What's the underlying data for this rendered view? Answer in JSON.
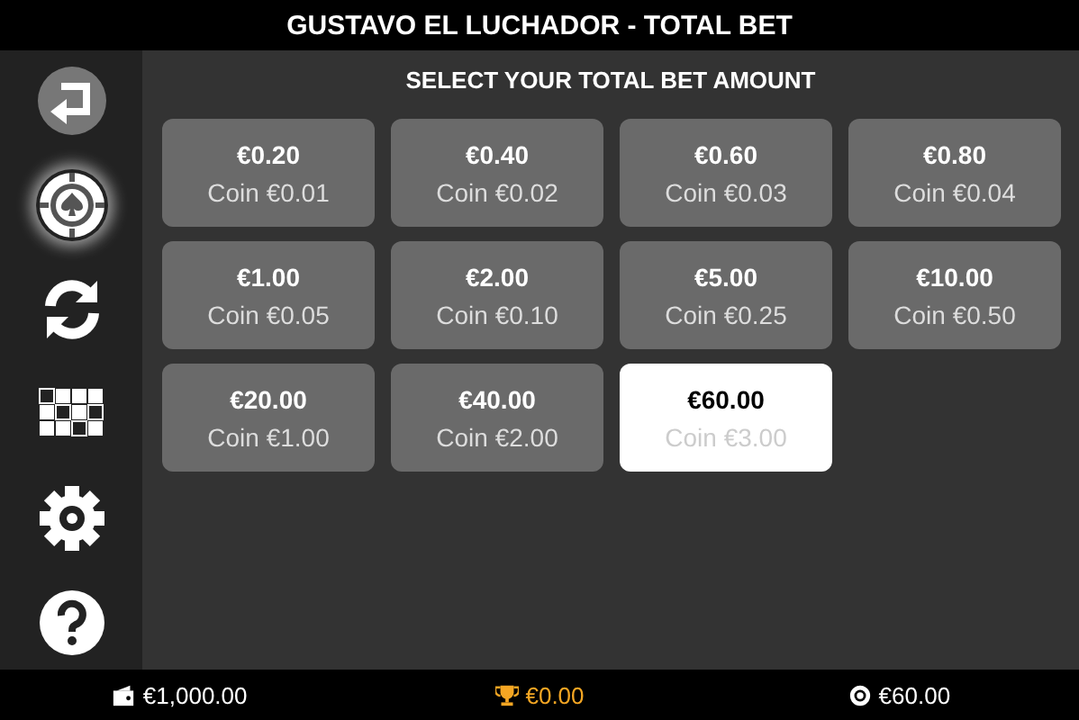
{
  "header": {
    "title": "GUSTAVO EL LUCHADOR - TOTAL BET"
  },
  "sidebar": {
    "items": [
      {
        "kind": "back",
        "selected": false
      },
      {
        "kind": "bet",
        "selected": true
      },
      {
        "kind": "autoplay",
        "selected": false
      },
      {
        "kind": "paytable",
        "selected": false
      },
      {
        "kind": "settings",
        "selected": false
      },
      {
        "kind": "help",
        "selected": false
      }
    ]
  },
  "panel": {
    "heading": "SELECT YOUR TOTAL BET AMOUNT",
    "options": [
      {
        "amount": "€0.20",
        "coin": "Coin €0.01",
        "selected": false
      },
      {
        "amount": "€0.40",
        "coin": "Coin €0.02",
        "selected": false
      },
      {
        "amount": "€0.60",
        "coin": "Coin €0.03",
        "selected": false
      },
      {
        "amount": "€0.80",
        "coin": "Coin €0.04",
        "selected": false
      },
      {
        "amount": "€1.00",
        "coin": "Coin €0.05",
        "selected": false
      },
      {
        "amount": "€2.00",
        "coin": "Coin €0.10",
        "selected": false
      },
      {
        "amount": "€5.00",
        "coin": "Coin €0.25",
        "selected": false
      },
      {
        "amount": "€10.00",
        "coin": "Coin €0.50",
        "selected": false
      },
      {
        "amount": "€20.00",
        "coin": "Coin €1.00",
        "selected": false
      },
      {
        "amount": "€40.00",
        "coin": "Coin €2.00",
        "selected": false
      },
      {
        "amount": "€60.00",
        "coin": "Coin €3.00",
        "selected": true
      }
    ]
  },
  "status_bar": [
    {
      "kind": "balance",
      "value": "€1,000.00"
    },
    {
      "kind": "win",
      "value": "€0.00"
    },
    {
      "kind": "bet",
      "value": "€60.00"
    }
  ]
}
